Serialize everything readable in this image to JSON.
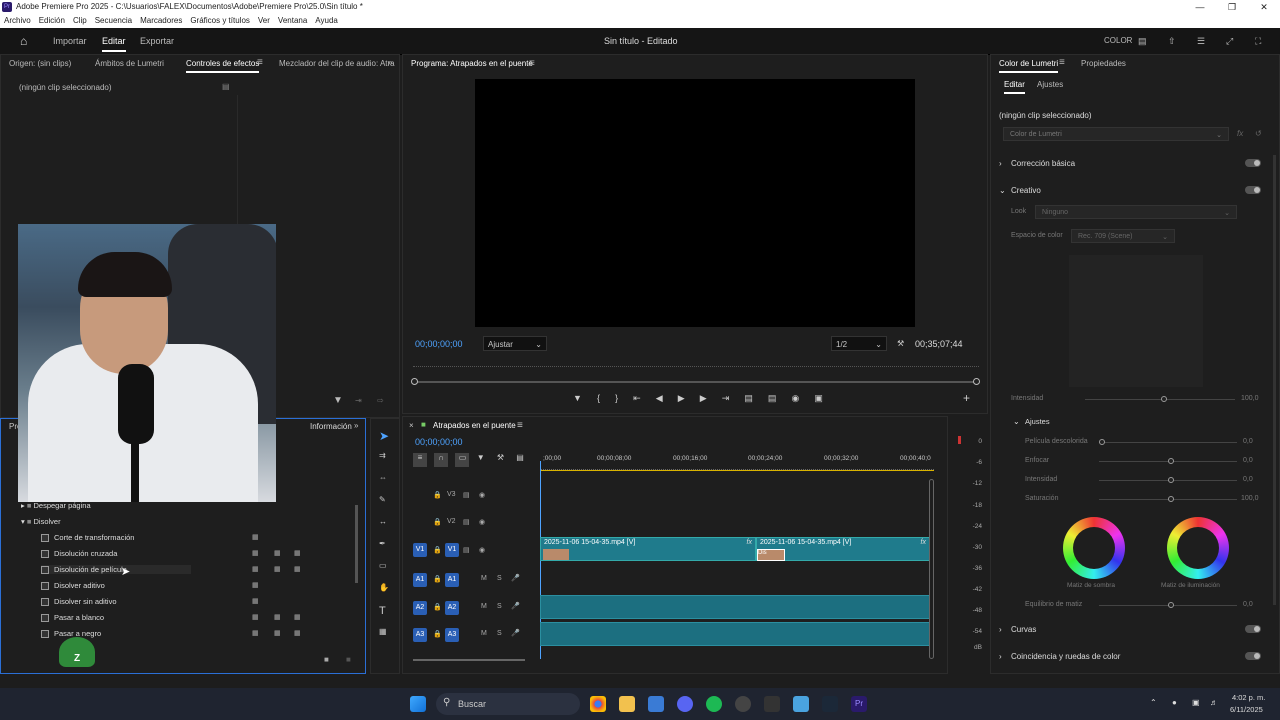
{
  "window": {
    "title": "Adobe Premiere Pro 2025 - C:\\Usuarios\\FALEX\\Documentos\\Adobe\\Premiere Pro\\25.0\\Sin título *",
    "pr_icon": "Pr"
  },
  "menu": [
    "Archivo",
    "Edición",
    "Clip",
    "Secuencia",
    "Marcadores",
    "Gráficos y títulos",
    "Ver",
    "Ventana",
    "Ayuda"
  ],
  "appbar": {
    "importar": "Importar",
    "editar": "Editar",
    "exportar": "Exportar",
    "center_title": "Sin título - Editado",
    "color": "COLOR"
  },
  "source_panel": {
    "tabs": [
      "Origen: (sin clips)",
      "Ámbitos de Lumetri",
      "Controles de efectos",
      "Mezclador del clip de audio: Atra"
    ],
    "no_clip": "(ningún clip seleccionado)"
  },
  "program": {
    "title": "Programa: Atrapados en el puente",
    "timecode": "00;00;00;00",
    "fit": "Ajustar",
    "quality": "1/2",
    "duration": "00;35;07;44"
  },
  "effects_panel": {
    "tab_info": "Información",
    "tab_project": "Proy",
    "items": [
      {
        "label": "Despegar página",
        "type": "folder",
        "collapsed": true
      },
      {
        "label": "Disolver",
        "type": "folder",
        "collapsed": false
      },
      {
        "label": "Corte de transformación"
      },
      {
        "label": "Disolución cruzada"
      },
      {
        "label": "Disolución de película"
      },
      {
        "label": "Disolver aditivo"
      },
      {
        "label": "Disolver sin aditivo"
      },
      {
        "label": "Pasar a blanco"
      },
      {
        "label": "Pasar a negro"
      }
    ]
  },
  "timeline": {
    "title": "Atrapados en el puente",
    "timecode": "00;00;00;00",
    "ruler": [
      ";00;00",
      "00;00;08;00",
      "00;00;16;00",
      "00;00;24;00",
      "00;00;32;00",
      "00;00;40;0"
    ],
    "tracks": {
      "v3": "V3",
      "v2": "V2",
      "v1": "V1",
      "a1": "A1",
      "a2": "A2",
      "a3": "A3",
      "m": "M",
      "s": "S"
    },
    "clip1": "2025-11-06 15-04-35.mp4 [V]",
    "clip2": "2025-11-06 15-04-35.mp4 [V]",
    "fx": "fx",
    "dis": "Dis"
  },
  "vu": [
    "0",
    "-6",
    "-12",
    "-18",
    "-24",
    "-30",
    "-36",
    "-42",
    "-48",
    "-54",
    "dB"
  ],
  "lumetri": {
    "tab": "Color de Lumetri",
    "tab2": "Propiedades",
    "sub_editar": "Editar",
    "sub_ajustes": "Ajustes",
    "no_clip": "(ningún clip seleccionado)",
    "preset": "Color de Lumetri",
    "basic": "Corrección básica",
    "creative": "Creativo",
    "look_label": "Look",
    "look_value": "Ninguno",
    "space_label": "Espacio de color",
    "space_value": "Rec. 709 (Scene)",
    "intensity_label": "Intensidad",
    "intensity_val": "100,0",
    "adjust": "Ajustes",
    "faded": "Película descolorida",
    "faded_val": "0,0",
    "sharpen": "Enfocar",
    "sharpen_val": "0,0",
    "intensity2": "Intensidad",
    "intensity2_val": "0,0",
    "saturation": "Saturación",
    "saturation_val": "100,0",
    "shadow": "Matiz de sombra",
    "highlight": "Matiz de iluminación",
    "balance": "Equilibrio de matiz",
    "balance_val": "0,0",
    "curves": "Curvas",
    "match": "Coincidencia y ruedas de color"
  },
  "taskbar": {
    "search": "Buscar",
    "time": "4:02 p. m.",
    "date": "6/11/2025"
  },
  "colors": {
    "accent": "#2a5fb5",
    "clip": "#1f7b8c",
    "audio": "#1c6f80"
  }
}
